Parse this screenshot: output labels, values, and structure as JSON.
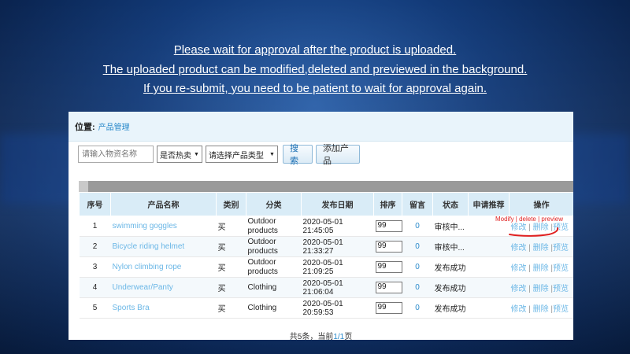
{
  "notice": {
    "line1": "Please wait for approval after the product is uploaded.",
    "line2": "The uploaded product can be modified,deleted and previewed in the background.",
    "line3": "If you re-submit, you need to be patient to wait for approval again."
  },
  "breadcrumb": {
    "label": "位置:",
    "value": "产品管理"
  },
  "filters": {
    "name_placeholder": "请输入物资名称",
    "hot_select": "是否热卖",
    "type_select": "请选择产品类型",
    "search_label": "搜索",
    "add_label": "添加产品"
  },
  "table": {
    "headers": [
      "序号",
      "产品名称",
      "类别",
      "分类",
      "发布日期",
      "排序",
      "留言",
      "状态",
      "申请推荐",
      "操作"
    ],
    "rows": [
      {
        "no": "1",
        "name": "swimming goggles",
        "type": "买",
        "category": "Outdoor products",
        "date": "2020-05-01 21:45:05",
        "sort": "99",
        "msg": "0",
        "status": "审核中...",
        "rec": "",
        "edit": "修改",
        "del": "删除",
        "preview": "预览"
      },
      {
        "no": "2",
        "name": "Bicycle riding helmet",
        "type": "买",
        "category": "Outdoor products",
        "date": "2020-05-01 21:33:27",
        "sort": "99",
        "msg": "0",
        "status": "审核中...",
        "rec": "",
        "edit": "修改",
        "del": "删除",
        "preview": "预览"
      },
      {
        "no": "3",
        "name": "Nylon climbing rope",
        "type": "买",
        "category": "Outdoor products",
        "date": "2020-05-01 21:09:25",
        "sort": "99",
        "msg": "0",
        "status": "发布成功",
        "rec": "",
        "edit": "修改",
        "del": "删除",
        "preview": "预览"
      },
      {
        "no": "4",
        "name": "Underwear/Panty",
        "type": "买",
        "category": "Clothing",
        "date": "2020-05-01 21:06:04",
        "sort": "99",
        "msg": "0",
        "status": "发布成功",
        "rec": "",
        "edit": "修改",
        "del": "删除",
        "preview": "预览"
      },
      {
        "no": "5",
        "name": "Sports Bra",
        "type": "买",
        "category": "Clothing",
        "date": "2020-05-01 20:59:53",
        "sort": "99",
        "msg": "0",
        "status": "发布成功",
        "rec": "",
        "edit": "修改",
        "del": "删除",
        "preview": "预览"
      }
    ]
  },
  "annotation": {
    "text": "Modify | delete | preview",
    "color": "#e02020"
  },
  "pager": {
    "prefix": "共5条，当前",
    "current": "1/1",
    "suffix": "页"
  },
  "colors": {
    "link": "#6bb7e6",
    "header_bg": "#d9ecf7",
    "accent": "#2a8acb"
  }
}
